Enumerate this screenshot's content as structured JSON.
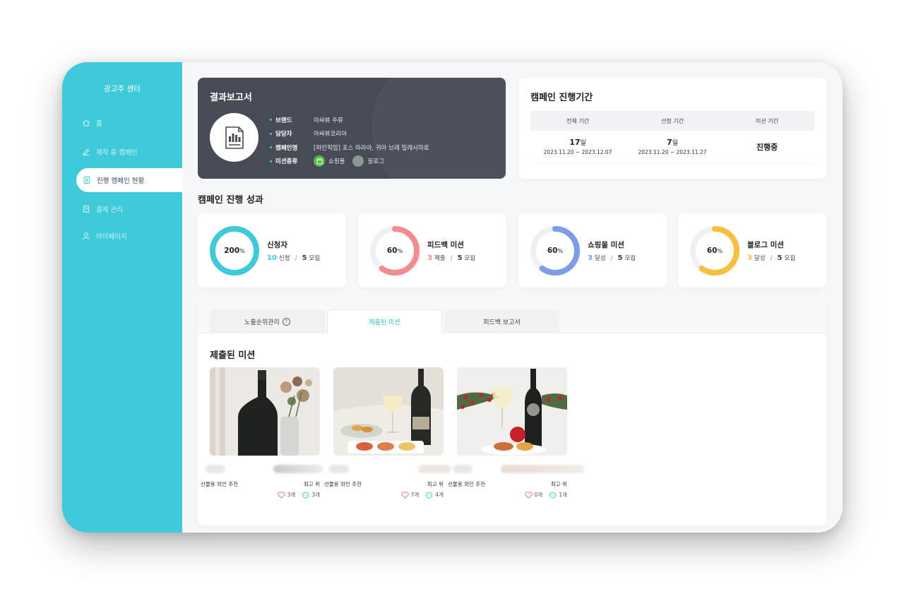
{
  "sidebar": {
    "brand": "광고주 센터",
    "items": [
      {
        "label": "홈",
        "icon": "home-icon"
      },
      {
        "label": "제작 중 캠페인",
        "icon": "pencil-icon"
      },
      {
        "label": "진행 캠페인 현황",
        "icon": "document-icon",
        "active": true
      },
      {
        "label": "결제 관리",
        "icon": "receipt-icon"
      },
      {
        "label": "마이페이지",
        "icon": "user-icon"
      }
    ]
  },
  "report": {
    "title": "결과보고서",
    "rows": [
      {
        "key": "브랜드",
        "value": "아싸뷰 주류"
      },
      {
        "key": "담당자",
        "value": "아싸뷰코리아"
      },
      {
        "key": "캠페인명",
        "value": "[와인픽업] 포스 마라아, 귀아 브레 밀레시마로"
      },
      {
        "key": "미션종류",
        "value1": "쇼핑몰",
        "value2": "블로그"
      }
    ]
  },
  "period": {
    "title": "캠페인 진행기간",
    "headers": [
      "전체 기간",
      "선정 기간",
      "미션 기간"
    ],
    "total": {
      "days": "17",
      "unit": "일",
      "range": "2023.11.20 ~ 2023.12.07"
    },
    "selection": {
      "days": "7",
      "unit": "일",
      "range": "2023.11.20 ~ 2023.11.27"
    },
    "mission": {
      "status": "진행중"
    }
  },
  "performance": {
    "title": "캠페인 진행 성과",
    "cards": [
      {
        "title": "신청자",
        "percent": "200",
        "percent_unit": "%",
        "progress": 1.0,
        "count": "10",
        "count_label": "신청",
        "sep": "/",
        "total": "5",
        "total_label": "모집",
        "color": "#3ecad9"
      },
      {
        "title": "피드백 미션",
        "percent": "60",
        "percent_unit": "%",
        "progress": 0.6,
        "count": "3",
        "count_label": "제출",
        "sep": "/",
        "total": "5",
        "total_label": "모집",
        "color": "#f48b8e"
      },
      {
        "title": "쇼핑몰 미션",
        "percent": "60",
        "percent_unit": "%",
        "progress": 0.6,
        "count": "3",
        "count_label": "달성",
        "sep": "/",
        "total": "5",
        "total_label": "모집",
        "color": "#7b9de8"
      },
      {
        "title": "블로그 미션",
        "percent": "60",
        "percent_unit": "%",
        "progress": 0.6,
        "count": "3",
        "count_label": "달성",
        "sep": "/",
        "total": "5",
        "total_label": "모집",
        "color": "#f8bf3e"
      }
    ]
  },
  "tabs": [
    {
      "label": "노출순위관리",
      "help": "?"
    },
    {
      "label": "제출된 미션"
    },
    {
      "label": "피드백 보고서"
    }
  ],
  "missions": {
    "title": "제출된 미션",
    "cards": [
      {
        "tag": "선물용 와인 추천",
        "best": "최고 위",
        "likes": "3개",
        "comments": "3개"
      },
      {
        "tag": "선물용 와인 추천",
        "best": "최고 위",
        "likes": "7개",
        "comments": "4개"
      },
      {
        "tag": "선물용 와인 추천",
        "best": "최고 위",
        "likes": "0개",
        "comments": "1개"
      }
    ]
  },
  "colors": {
    "accent": "#3ecad9",
    "report_bg": "#464b55"
  }
}
